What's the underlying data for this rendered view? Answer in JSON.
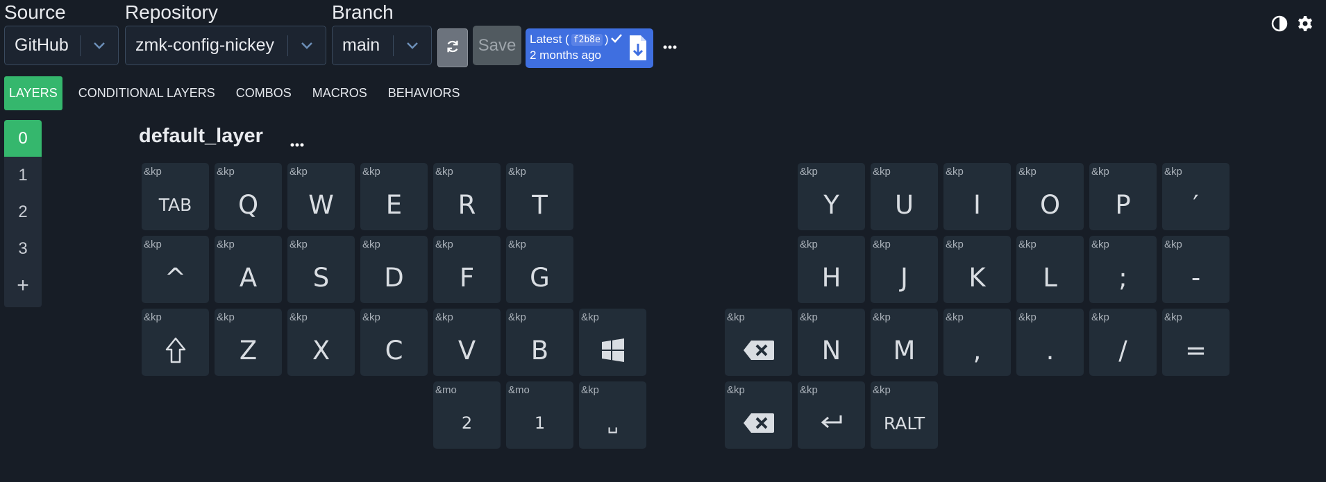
{
  "selectors": {
    "source": {
      "label": "Source",
      "value": "GitHub"
    },
    "repository": {
      "label": "Repository",
      "value": "zmk-config-nickey"
    },
    "branch": {
      "label": "Branch",
      "value": "main"
    }
  },
  "toolbar": {
    "save_label": "Save",
    "latest": {
      "prefix": "Latest (",
      "hash": "f2b8e",
      "suffix": ")",
      "time": "2 months ago"
    }
  },
  "tabs": [
    {
      "label": "LAYERS",
      "active": true
    },
    {
      "label": "CONDITIONAL LAYERS",
      "active": false
    },
    {
      "label": "COMBOS",
      "active": false
    },
    {
      "label": "MACROS",
      "active": false
    },
    {
      "label": "BEHAVIORS",
      "active": false
    }
  ],
  "layers": [
    "0",
    "1",
    "2",
    "3"
  ],
  "add_layer_label": "+",
  "layer_title": "default_layer",
  "colors": {
    "accent": "#35b76d",
    "latest": "#3f6fe0",
    "background": "#171d26",
    "key": "#222d38"
  },
  "keys": [
    {
      "b": "&kp",
      "p": "TAB",
      "style": "small"
    },
    {
      "b": "&kp",
      "p": "Q"
    },
    {
      "b": "&kp",
      "p": "W"
    },
    {
      "b": "&kp",
      "p": "E"
    },
    {
      "b": "&kp",
      "p": "R"
    },
    {
      "b": "&kp",
      "p": "T"
    },
    {
      "b": "&kp",
      "p": "Y"
    },
    {
      "b": "&kp",
      "p": "U"
    },
    {
      "b": "&kp",
      "p": "I"
    },
    {
      "b": "&kp",
      "p": "O"
    },
    {
      "b": "&kp",
      "p": "P"
    },
    {
      "b": "&kp",
      "p": "′"
    },
    {
      "b": "&kp",
      "p": "^"
    },
    {
      "b": "&kp",
      "p": "A"
    },
    {
      "b": "&kp",
      "p": "S"
    },
    {
      "b": "&kp",
      "p": "D"
    },
    {
      "b": "&kp",
      "p": "F"
    },
    {
      "b": "&kp",
      "p": "G"
    },
    {
      "b": "&kp",
      "p": "H"
    },
    {
      "b": "&kp",
      "p": "J"
    },
    {
      "b": "&kp",
      "p": "K"
    },
    {
      "b": "&kp",
      "p": "L"
    },
    {
      "b": "&kp",
      "p": ";"
    },
    {
      "b": "&kp",
      "p": "-"
    },
    {
      "b": "&kp",
      "icon": "shift-icon"
    },
    {
      "b": "&kp",
      "p": "Z"
    },
    {
      "b": "&kp",
      "p": "X"
    },
    {
      "b": "&kp",
      "p": "C"
    },
    {
      "b": "&kp",
      "p": "V"
    },
    {
      "b": "&kp",
      "p": "B"
    },
    {
      "b": "&kp",
      "icon": "windows-icon"
    },
    {
      "b": "&kp",
      "icon": "backspace-icon"
    },
    {
      "b": "&kp",
      "p": "N"
    },
    {
      "b": "&kp",
      "p": "M"
    },
    {
      "b": "&kp",
      "p": ","
    },
    {
      "b": "&kp",
      "p": "."
    },
    {
      "b": "&kp",
      "p": "/"
    },
    {
      "b": "&kp",
      "p": "="
    },
    {
      "b": "&mo",
      "p": "2",
      "style": "tiny"
    },
    {
      "b": "&mo",
      "p": "1",
      "style": "tiny"
    },
    {
      "b": "&kp",
      "p": "␣",
      "style": "small"
    },
    {
      "b": "&kp",
      "icon": "backspace-icon"
    },
    {
      "b": "&kp",
      "icon": "enter-icon"
    },
    {
      "b": "&kp",
      "p": "RALT",
      "style": "small"
    }
  ]
}
